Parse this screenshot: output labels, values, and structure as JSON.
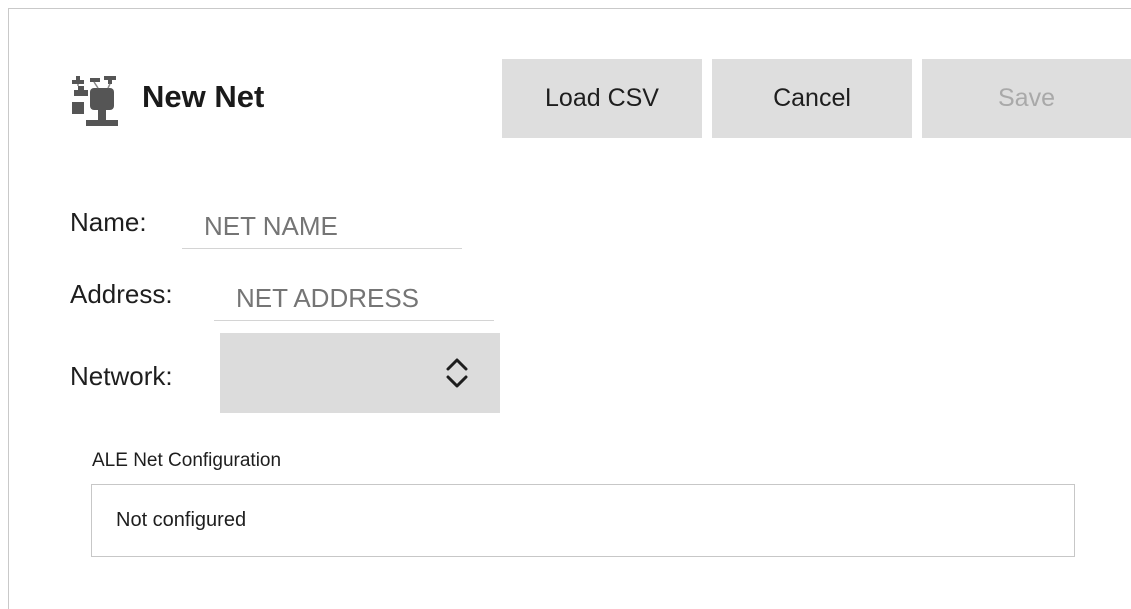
{
  "header": {
    "icon": "network-tree-icon",
    "title": "New Net"
  },
  "toolbar": {
    "load_csv_label": "Load CSV",
    "cancel_label": "Cancel",
    "save_label": "Save"
  },
  "form": {
    "name": {
      "label": "Name:",
      "placeholder": "NET NAME",
      "value": ""
    },
    "address": {
      "label": "Address:",
      "placeholder": "NET ADDRESS",
      "value": ""
    },
    "network": {
      "label": "Network:",
      "value": "",
      "icon": "chevron-up-down-icon"
    }
  },
  "ale_config": {
    "label": "ALE Net Configuration",
    "value": "Not configured"
  },
  "colors": {
    "button_bg": "#dedede",
    "disabled_text": "#a9a9a9",
    "select_bg": "#dcdcdc"
  }
}
